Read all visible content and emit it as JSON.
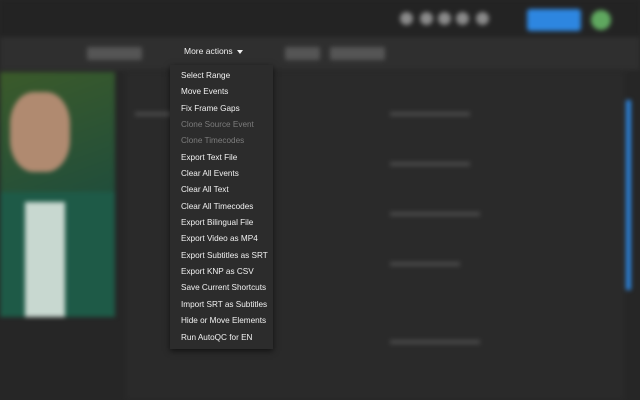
{
  "toolbar": {
    "more_actions_label": "More actions"
  },
  "menu": {
    "items": [
      {
        "label": "Select Range",
        "enabled": true
      },
      {
        "label": "Move Events",
        "enabled": true
      },
      {
        "label": "Fix Frame Gaps",
        "enabled": true
      },
      {
        "label": "Clone Source Event",
        "enabled": false
      },
      {
        "label": "Clone Timecodes",
        "enabled": false
      },
      {
        "label": "Export Text File",
        "enabled": true
      },
      {
        "label": "Clear All Events",
        "enabled": true
      },
      {
        "label": "Clear All Text",
        "enabled": true
      },
      {
        "label": "Clear All Timecodes",
        "enabled": true
      },
      {
        "label": "Export Bilingual File",
        "enabled": true
      },
      {
        "label": "Export Video as MP4",
        "enabled": true
      },
      {
        "label": "Export Subtitles as SRT",
        "enabled": true
      },
      {
        "label": "Export KNP as CSV",
        "enabled": true
      },
      {
        "label": "Save Current Shortcuts",
        "enabled": true
      },
      {
        "label": "Import SRT as Subtitles",
        "enabled": true
      },
      {
        "label": "Hide or Move Elements",
        "enabled": true
      },
      {
        "label": "Run AutoQC for EN",
        "enabled": true
      }
    ]
  },
  "colors": {
    "accent": "#2d86e0",
    "menu_bg": "#2c2c2c"
  }
}
